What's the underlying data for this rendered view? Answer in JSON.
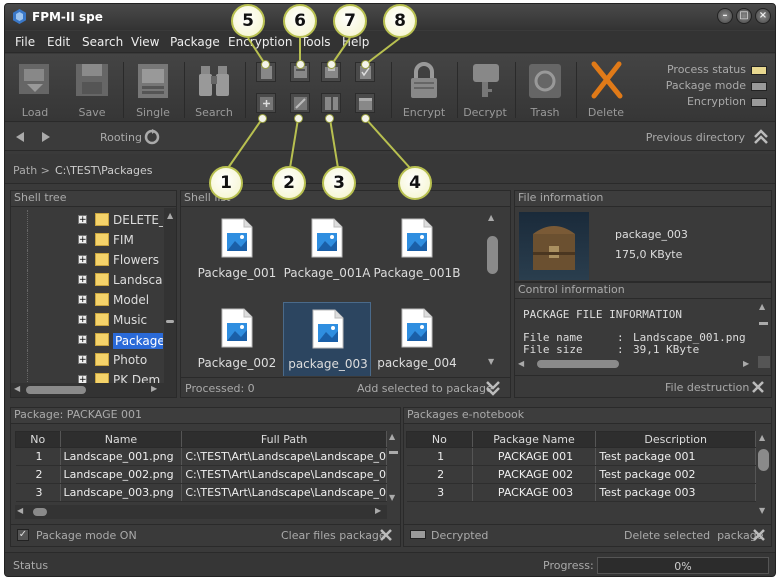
{
  "app": {
    "title": "FPM-II spe"
  },
  "menu": [
    "File",
    "Edit",
    "Search",
    "View",
    "Package",
    "Encryption",
    "Tools",
    "Help"
  ],
  "toolbar": {
    "load": "Load",
    "save": "Save",
    "single": "Single",
    "search": "Search",
    "encrypt": "Encrypt",
    "decrypt": "Decrypt",
    "trash": "Trash",
    "delete": "Delete"
  },
  "status_legend": {
    "process_status": "Process status",
    "package_mode": "Package mode",
    "encryption": "Encryption",
    "colors": {
      "process_status": "#e8d890",
      "package_mode": "#9a9a9a",
      "encryption": "#9a9a9a"
    }
  },
  "callouts": [
    "1",
    "2",
    "3",
    "4",
    "5",
    "6",
    "7",
    "8"
  ],
  "nav": {
    "rooting": "Rooting",
    "previous_directory": "Previous directory"
  },
  "path": {
    "label": "Path  >",
    "value": "C:\\TEST\\Packages"
  },
  "shell_tree": {
    "title": "Shell tree",
    "items": [
      "DELETE_",
      "FIM",
      "Flowers",
      "Landsca",
      "Model",
      "Music",
      "Package",
      "Photo",
      "PK Dem"
    ],
    "selected_index": 6
  },
  "shell_list": {
    "title": "Shell list",
    "files": [
      "Package_001",
      "Package_001A",
      "Package_001B",
      "Package_002",
      "package_003",
      "package_004"
    ],
    "selected_index": 4,
    "processed": "Processed: 0",
    "add_selected": "Add selected to package"
  },
  "file_info": {
    "title": "File information",
    "name": "package_003",
    "size": "175,0 KByte"
  },
  "control_info": {
    "title": "Control information",
    "heading": "PACKAGE FILE INFORMATION",
    "rows": [
      {
        "key": "File name",
        "sep": ":",
        "value": "Landscape_001.png"
      },
      {
        "key": "File size",
        "sep": ":",
        "value": "39,1 KByte"
      }
    ],
    "file_destruction": "File destruction"
  },
  "package_panel": {
    "title": "Package: PACKAGE 001",
    "columns": [
      "No",
      "Name",
      "Full Path"
    ],
    "rows": [
      [
        "1",
        "Landscape_001.png",
        "C:\\TEST\\Art\\Landscape\\Landscape_0"
      ],
      [
        "2",
        "Landscape_002.png",
        "C:\\TEST\\Art\\Landscape\\Landscape_0"
      ],
      [
        "3",
        "Landscape_003.png",
        "C:\\TEST\\Art\\Landscape\\Landscape_0"
      ]
    ],
    "mode_label": "Package mode ON",
    "mode_checked": true,
    "clear": "Clear files package"
  },
  "notebook_panel": {
    "title": "Packages e-notebook",
    "columns": [
      "No",
      "Package Name",
      "Description"
    ],
    "rows": [
      [
        "1",
        "PACKAGE 001",
        "Test package 001"
      ],
      [
        "2",
        "PACKAGE 002",
        "Test package 002"
      ],
      [
        "3",
        "PACKAGE 003",
        "Test package 003"
      ]
    ],
    "decrypted": "Decrypted",
    "delete_selected": "Delete selected  package"
  },
  "statusbar": {
    "status": "Status",
    "progress_label": "Progress:",
    "progress_value": "0%",
    "progress_fraction": 0
  }
}
